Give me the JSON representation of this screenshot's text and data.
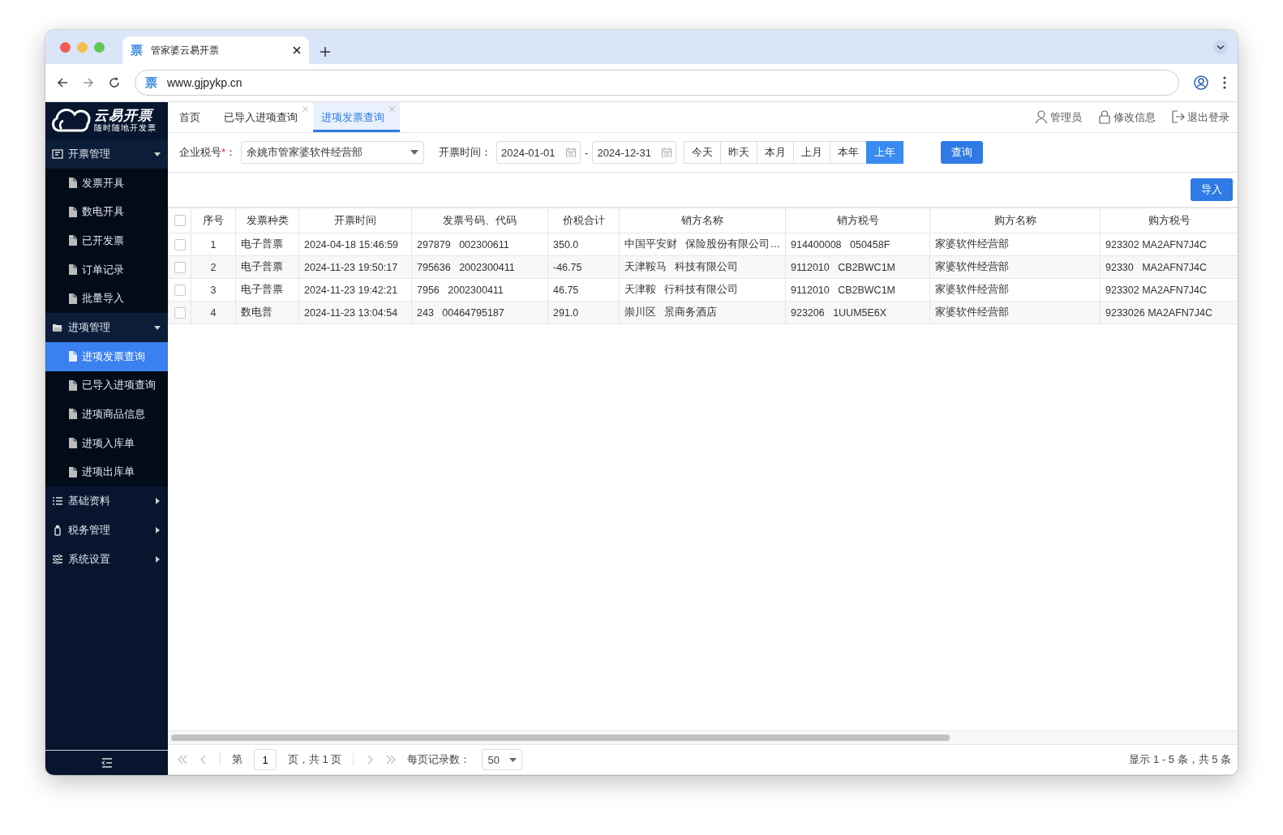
{
  "browser": {
    "tab": {
      "favicon": "票",
      "title": "管家婆云易开票"
    },
    "address": {
      "favicon": "票",
      "url": "www.gjpykp.cn"
    }
  },
  "sidebar": {
    "logo": {
      "title": "云易开票",
      "subtitle": "随时随地开发票"
    },
    "groups": [
      {
        "label": "开票管理",
        "expanded": true,
        "children": [
          {
            "label": "发票开具",
            "selected": false
          },
          {
            "label": "数电开具",
            "selected": false
          },
          {
            "label": "已开发票",
            "selected": false
          },
          {
            "label": "订单记录",
            "selected": false
          },
          {
            "label": "批量导入",
            "selected": false
          }
        ]
      },
      {
        "label": "进项管理",
        "expanded": true,
        "children": [
          {
            "label": "进项发票查询",
            "selected": true
          },
          {
            "label": "已导入进项查询",
            "selected": false
          },
          {
            "label": "进项商品信息",
            "selected": false
          },
          {
            "label": "进项入库单",
            "selected": false
          },
          {
            "label": "进项出库单",
            "selected": false
          }
        ]
      },
      {
        "label": "基础资料",
        "expanded": false
      },
      {
        "label": "税务管理",
        "expanded": false
      },
      {
        "label": "系统设置",
        "expanded": false
      }
    ]
  },
  "tabs": [
    {
      "label": "首页",
      "closable": false,
      "selected": false
    },
    {
      "label": "已导入进项查询",
      "closable": true,
      "selected": false
    },
    {
      "label": "进项发票查询",
      "closable": true,
      "selected": true
    }
  ],
  "user_menu": [
    "管理员",
    "修改信息",
    "退出登录"
  ],
  "filters": {
    "company": {
      "label": "企业税号",
      "required_mark": "*",
      "suffix": "：",
      "value": "余姚市管家婆软件经营部"
    },
    "date": {
      "label": "开票时间：",
      "start": "2024-01-01",
      "separator": "-",
      "end": "2024-12-31"
    },
    "quick_ranges": [
      {
        "label": "今天",
        "selected": false
      },
      {
        "label": "昨天",
        "selected": false
      },
      {
        "label": "本月",
        "selected": false
      },
      {
        "label": "上月",
        "selected": false
      },
      {
        "label": "本年",
        "selected": false
      },
      {
        "label": "上年",
        "selected": true
      }
    ],
    "search_button": "查询"
  },
  "toolbar": {
    "import_button": "导入"
  },
  "table": {
    "select_all_checked": false,
    "columns": [
      "序号",
      "发票种类",
      "开票时间",
      "发票号码、代码",
      "价税合计",
      "销方名称",
      "销方税号",
      "购方名称",
      "购方税号"
    ],
    "rows": [
      {
        "checked": false,
        "cells": [
          "1",
          "电子普票",
          "2024-04-18 15:46:59",
          "297879   002300611",
          "350.0",
          "中国平安财   保险股份有限公司…",
          "914400008   050458F",
          "家婆软件经营部",
          "923302 MA2AFN7J4C"
        ]
      },
      {
        "checked": false,
        "cells": [
          "2",
          "电子普票",
          "2024-11-23 19:50:17",
          "795636   2002300411",
          "-46.75",
          "天津鞍马   科技有限公司",
          "9112010   CB2BWC1M",
          "家婆软件经营部",
          "92330   MA2AFN7J4C"
        ]
      },
      {
        "checked": false,
        "cells": [
          "3",
          "电子普票",
          "2024-11-23 19:42:21",
          "7956   2002300411",
          "46.75",
          "天津鞍   行科技有限公司",
          "9112010   CB2BWC1M",
          "家婆软件经营部",
          "923302 MA2AFN7J4C"
        ]
      },
      {
        "checked": false,
        "cells": [
          "4",
          "数电普",
          "2024-11-23 13:04:54",
          "243   00464795187",
          "291.0",
          "崇川区   景商务酒店",
          "923206   1UUM5E6X",
          "家婆软件经营部",
          "9233026 MA2AFN7J4C"
        ]
      }
    ]
  },
  "pagination": {
    "page_prefix": "第",
    "page": "1",
    "page_suffix": "页，共 1 页",
    "page_size_label": "每页记录数：",
    "page_size": "50",
    "summary": "显示 1 - 5 条，共 5 条"
  }
}
